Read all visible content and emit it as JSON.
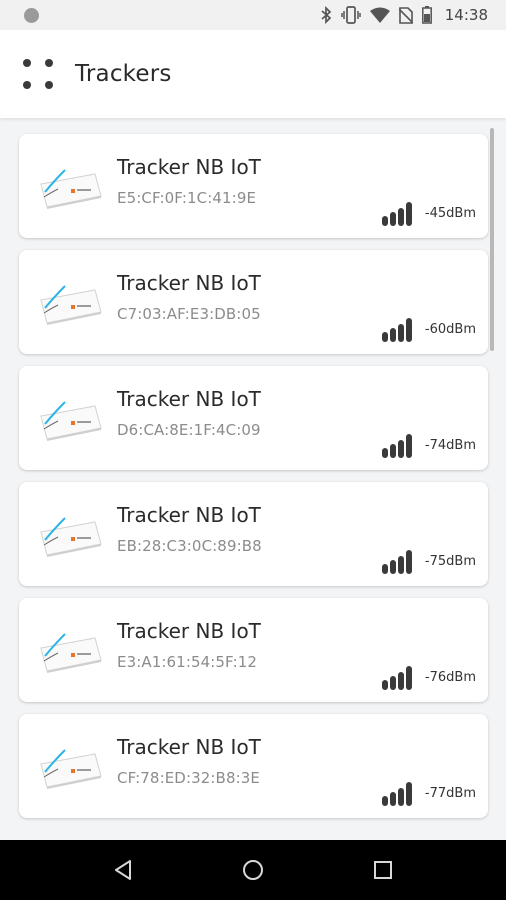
{
  "status_bar": {
    "time": "14:38",
    "icons": [
      "bluetooth-icon",
      "vibrate-icon",
      "wifi-icon",
      "no-sim-icon",
      "battery-icon"
    ]
  },
  "app_bar": {
    "title": "Trackers",
    "menu_icon": "apps-grid-icon"
  },
  "trackers": [
    {
      "name": "Tracker NB IoT",
      "mac": "E5:CF:0F:1C:41:9E",
      "rssi": "-45dBm"
    },
    {
      "name": "Tracker NB IoT",
      "mac": "C7:03:AF:E3:DB:05",
      "rssi": "-60dBm"
    },
    {
      "name": "Tracker NB IoT",
      "mac": "D6:CA:8E:1F:4C:09",
      "rssi": "-74dBm"
    },
    {
      "name": "Tracker NB IoT",
      "mac": "EB:28:C3:0C:89:B8",
      "rssi": "-75dBm"
    },
    {
      "name": "Tracker NB IoT",
      "mac": "E3:A1:61:54:5F:12",
      "rssi": "-76dBm"
    },
    {
      "name": "Tracker NB IoT",
      "mac": "CF:78:ED:32:B8:3E",
      "rssi": "-77dBm"
    }
  ],
  "nav_bar": {
    "icons": [
      "back-icon",
      "home-icon",
      "recents-icon"
    ]
  },
  "colors": {
    "background": "#f3f4f6",
    "card": "#ffffff",
    "nav_bar": "#000000",
    "signal": "#3a3a3a",
    "accent": "#2bb5e6"
  }
}
